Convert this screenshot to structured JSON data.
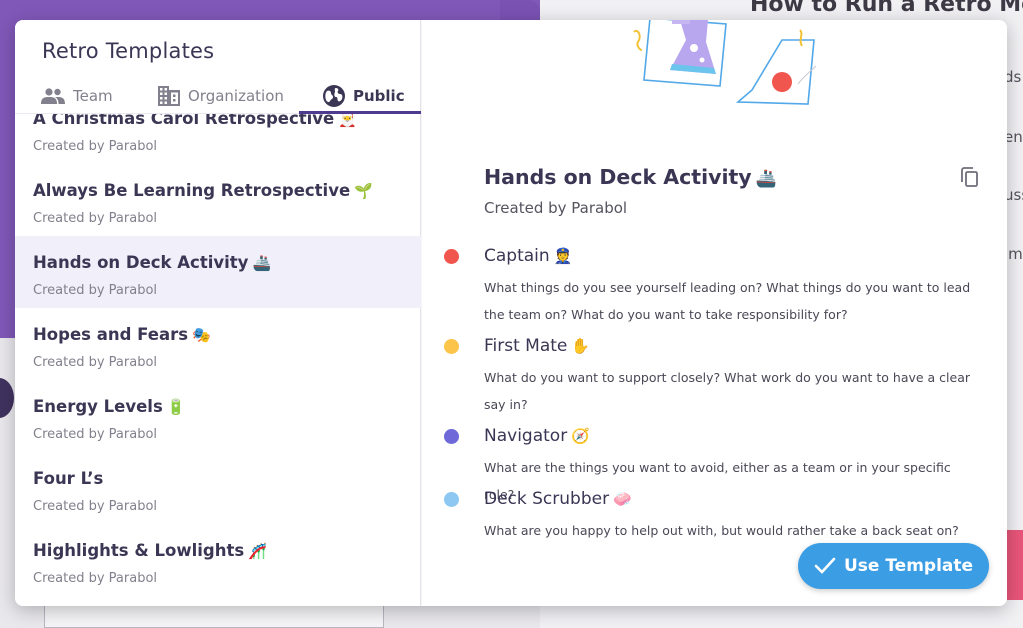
{
  "backdrop": {
    "heading": "How to Run a Retro Me",
    "fragments": [
      "ds",
      "en",
      "uss",
      "im"
    ]
  },
  "modal": {
    "title": "Retro Templates",
    "tabs": [
      {
        "label": "Team",
        "icon": "team-icon"
      },
      {
        "label": "Organization",
        "icon": "organization-icon"
      },
      {
        "label": "Public",
        "icon": "globe-icon",
        "active": true
      }
    ]
  },
  "templates": [
    {
      "name": "A Christmas Carol Retrospective",
      "emoji": "🎅",
      "creator": "Created by Parabol"
    },
    {
      "name": "Always Be Learning Retrospective",
      "emoji": "🌱",
      "creator": "Created by Parabol"
    },
    {
      "name": "Hands on Deck Activity",
      "emoji": "🚢",
      "creator": "Created by Parabol",
      "selected": true
    },
    {
      "name": "Hopes and Fears",
      "emoji": "🎭",
      "creator": "Created by Parabol"
    },
    {
      "name": "Energy Levels",
      "emoji": "🔋",
      "creator": "Created by Parabol"
    },
    {
      "name": "Four L’s",
      "emoji": "",
      "creator": "Created by Parabol"
    },
    {
      "name": "Highlights & Lowlights",
      "emoji": "🎢",
      "creator": "Created by Parabol"
    }
  ],
  "detail": {
    "title": "Hands on Deck Activity",
    "emoji": "🚢",
    "creator": "Created by Parabol",
    "prompts": [
      {
        "title": "Captain",
        "emoji": "👮",
        "color": "#f0564d",
        "description": "What things do you see yourself leading on? What things do you want to lead the team on? What do you want to take responsibility for?"
      },
      {
        "title": "First Mate",
        "emoji": "✋",
        "color": "#fcc44a",
        "description": "What do you want to support closely? What work do you want to have a clear say in?"
      },
      {
        "title": "Navigator",
        "emoji": "🧭",
        "color": "#6e68d8",
        "description": "What are the things you want to avoid, either as a team or in your specific role?"
      },
      {
        "title": "Deck Scrubber",
        "emoji": "🧼",
        "color": "#8dc8f2",
        "description": "What are you happy to help out with, but would rather take a back seat on?"
      }
    ],
    "use_button": "Use Template"
  },
  "colors": {
    "accent": "#3b9de4",
    "tab_active": "#4e3b8f",
    "selected_row": "#f0effa",
    "backdrop_purple": "#8058b8"
  }
}
